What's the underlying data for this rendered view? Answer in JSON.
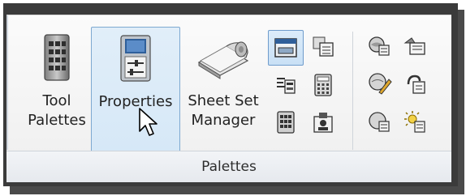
{
  "ribbon_panel": {
    "title": "Palettes",
    "buttons": {
      "tool_palettes": {
        "line1": "Tool",
        "line2": "Palettes"
      },
      "properties": {
        "line1": "Properties"
      },
      "sheet_set_manager": {
        "line1": "Sheet Set",
        "line2": "Manager"
      }
    },
    "small_icons": [
      "design-center-icon",
      "layer-states-icon",
      "attribute-icon",
      "calculator-icon",
      "tool-palette-grid-icon",
      "markup-icon",
      "dbconnect-icon",
      "edit-pencil-icon",
      "dbquery-icon",
      "hyperlink-icon",
      "render-icon",
      "light-icon"
    ]
  },
  "colors": {
    "selection_fill": "#d6e8f7",
    "selection_border": "#7ea9d1",
    "frame_dark": "#3b3b3b"
  }
}
